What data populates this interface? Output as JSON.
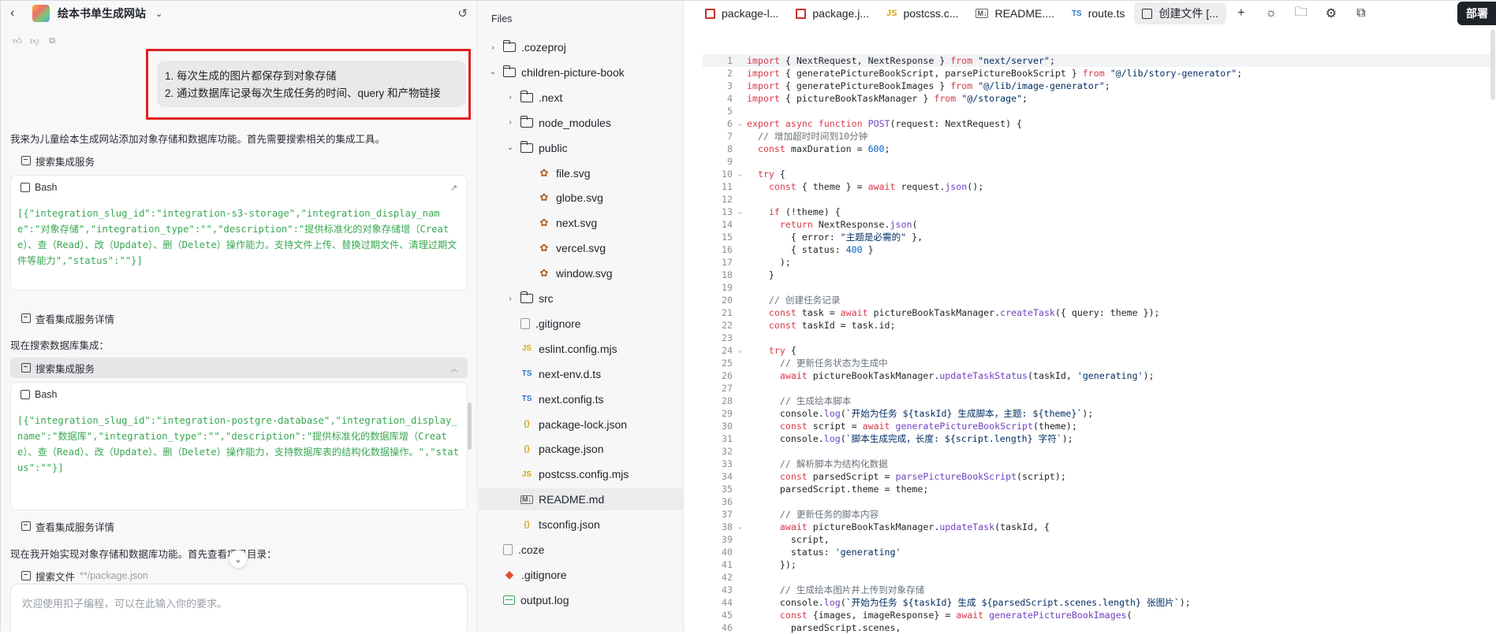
{
  "chat": {
    "project_title": "绘本书单生成网站",
    "user_message_lines": [
      "1. 每次生成的图片都保存到对象存储",
      "2. 通过数据库记录每次生成任务的时间、query 和产物链接"
    ],
    "para1": "我来为儿童绘本生成网站添加对象存储和数据库功能。首先需要搜索相关的集成工具。",
    "tool1_label": "搜索集成服务",
    "bash1_title": "Bash",
    "bash1_output": "[{\"integration_slug_id\":\"integration-s3-storage\",\"integration_display_name\":\"对象存储\",\"integration_type\":\"\",\"description\":\"提供标准化的对象存储增（Create）、查（Read）、改（Update）、删（Delete）操作能力。支持文件上传、替换过期文件、清理过期文件等能力\",\"status\":\"\"}]",
    "tool2_label": "查看集成服务详情",
    "para2": "现在搜索数据库集成：",
    "tool3_label": "搜索集成服务",
    "bash2_title": "Bash",
    "bash2_output": "[{\"integration_slug_id\":\"integration-postgre-database\",\"integration_display_name\":\"数据库\",\"integration_type\":\"\",\"description\":\"提供标准化的数据库增（Create）、查（Read）、改（Update）、删（Delete）操作能力，支持数据库表的结构化数据操作。\",\"status\":\"\"}]",
    "tool4_label": "查看集成服务详情",
    "para3": "现在我开始实现对象存储和数据库功能。首先查看项目目录：",
    "tool5_label": "搜索文件",
    "tool5_arg": "**/package.json",
    "input_placeholder": "欢迎使用扣子编程，可以在此输入你的要求。"
  },
  "tree": {
    "title": "Files",
    "nodes": [
      {
        "label": ".cozeproj",
        "kind": "folder",
        "depth": 0,
        "arrow": "›"
      },
      {
        "label": "children-picture-book",
        "kind": "folder",
        "depth": 0,
        "arrow": "⌄"
      },
      {
        "label": ".next",
        "kind": "folder",
        "depth": 1,
        "arrow": "›"
      },
      {
        "label": "node_modules",
        "kind": "folder",
        "depth": 1,
        "arrow": "›"
      },
      {
        "label": "public",
        "kind": "folder-open",
        "depth": 1,
        "arrow": "⌄"
      },
      {
        "label": "file.svg",
        "kind": "svg",
        "depth": 2
      },
      {
        "label": "globe.svg",
        "kind": "svg",
        "depth": 2
      },
      {
        "label": "next.svg",
        "kind": "svg",
        "depth": 2
      },
      {
        "label": "vercel.svg",
        "kind": "svg",
        "depth": 2
      },
      {
        "label": "window.svg",
        "kind": "svg",
        "depth": 2
      },
      {
        "label": "src",
        "kind": "folder",
        "depth": 1,
        "arrow": "›"
      },
      {
        "label": ".gitignore",
        "kind": "file",
        "depth": 1
      },
      {
        "label": "eslint.config.mjs",
        "kind": "js",
        "depth": 1
      },
      {
        "label": "next-env.d.ts",
        "kind": "ts",
        "depth": 1
      },
      {
        "label": "next.config.ts",
        "kind": "ts",
        "depth": 1
      },
      {
        "label": "package-lock.json",
        "kind": "json",
        "depth": 1
      },
      {
        "label": "package.json",
        "kind": "json",
        "depth": 1
      },
      {
        "label": "postcss.config.mjs",
        "kind": "js",
        "depth": 1
      },
      {
        "label": "README.md",
        "kind": "md",
        "depth": 1,
        "selected": true
      },
      {
        "label": "tsconfig.json",
        "kind": "json",
        "depth": 1
      },
      {
        "label": ".coze",
        "kind": "file",
        "depth": 0
      },
      {
        "label": ".gitignore",
        "kind": "git",
        "depth": 0
      },
      {
        "label": "output.log",
        "kind": "log",
        "depth": 0
      }
    ]
  },
  "editor": {
    "tabs": [
      {
        "label": "package-l...",
        "icon": "npm"
      },
      {
        "label": "package.j...",
        "icon": "npm"
      },
      {
        "label": "postcss.c...",
        "icon": "js"
      },
      {
        "label": "README....",
        "icon": "md"
      },
      {
        "label": "route.ts",
        "icon": "ts"
      },
      {
        "label": "创建文件 [...",
        "icon": "term",
        "active": true
      }
    ],
    "deploy_label": "部署",
    "current_line": 1,
    "fold_lines": [
      6,
      10,
      13,
      24,
      38
    ],
    "lines": [
      "import { NextRequest, NextResponse } from \"next/server\";",
      "import { generatePictureBookScript, parsePictureBookScript } from \"@/lib/story-generator\";",
      "import { generatePictureBookImages } from \"@/lib/image-generator\";",
      "import { pictureBookTaskManager } from \"@/storage\";",
      "",
      "export async function POST(request: NextRequest) {",
      "  // 增加超时时间到10分钟",
      "  const maxDuration = 600;",
      "",
      "  try {",
      "    const { theme } = await request.json();",
      "",
      "    if (!theme) {",
      "      return NextResponse.json(",
      "        { error: \"主题是必需的\" },",
      "        { status: 400 }",
      "      );",
      "    }",
      "",
      "    // 创建任务记录",
      "    const task = await pictureBookTaskManager.createTask({ query: theme });",
      "    const taskId = task.id;",
      "",
      "    try {",
      "      // 更新任务状态为生成中",
      "      await pictureBookTaskManager.updateTaskStatus(taskId, 'generating');",
      "",
      "      // 生成绘本脚本",
      "      console.log(`开始为任务 ${taskId} 生成脚本，主题: ${theme}`);",
      "      const script = await generatePictureBookScript(theme);",
      "      console.log(`脚本生成完成，长度: ${script.length} 字符`);",
      "",
      "      // 解析脚本为结构化数据",
      "      const parsedScript = parsePictureBookScript(script);",
      "      parsedScript.theme = theme;",
      "",
      "      // 更新任务的脚本内容",
      "      await pictureBookTaskManager.updateTask(taskId, {",
      "        script,",
      "        status: 'generating'",
      "      });",
      "",
      "      // 生成绘本图片并上传到对象存储",
      "      console.log(`开始为任务 ${taskId} 生成 ${parsedScript.scenes.length} 张图片`);",
      "      const {images, imageResponse} = await generatePictureBookImages(",
      "        parsedScript.scenes,"
    ]
  }
}
